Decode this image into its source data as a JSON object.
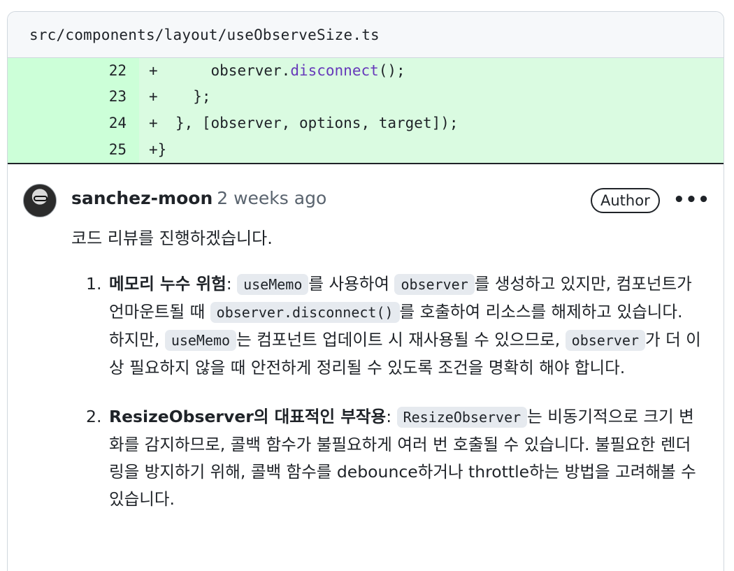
{
  "file_header": {
    "path": "src/components/layout/useObserveSize.ts"
  },
  "diff_lines": [
    {
      "line": "22",
      "prefix": "+",
      "before": "      observer.",
      "fn": "disconnect",
      "after": "();"
    },
    {
      "line": "23",
      "prefix": "+",
      "before": "    };",
      "fn": "",
      "after": ""
    },
    {
      "line": "24",
      "prefix": "+",
      "before": "  }, [observer, options, target]);",
      "fn": "",
      "after": ""
    },
    {
      "line": "25",
      "prefix": "+",
      "before": "}",
      "fn": "",
      "after": ""
    }
  ],
  "comment": {
    "author": "sanchez-moon",
    "time": "2 weeks ago",
    "badge": "Author",
    "menu": "•••",
    "intro": "코드 리뷰를 진행하겠습니다.",
    "items": [
      {
        "num": "1.",
        "term": "메모리 누수 위험",
        "p1": ": ",
        "c1": "useMemo",
        "p2": "를 사용하여 ",
        "c2": "observer",
        "p3": "를 생성하고 있지만, 컴포넌트가 언마운트될 때 ",
        "c3": "observer.disconnect()",
        "p4": "를 호출하여 리소스를 해제하고 있습니다. 하지만, ",
        "c4": "useMemo",
        "p5": "는 컴포넌트 업데이트 시 재사용될 수 있으므로, ",
        "c5": "observer",
        "p6": "가 더 이상 필요하지 않을 때 안전하게 정리될 수 있도록 조건을 명확히 해야 합니다."
      },
      {
        "num": "2.",
        "term": "ResizeObserver의 대표적인 부작용",
        "p1": ": ",
        "c1": "ResizeObserver",
        "p2": "는 비동기적으로 크기 변화를 감지하므로, 콜백 함수가 불필요하게 여러 번 호출될 수 있습니다. 불필요한 렌더링을 방지하기 위해, 콜백 함수를 debounce하거나 throttle하는 방법을 고려해볼 수 있습니다."
      }
    ]
  }
}
